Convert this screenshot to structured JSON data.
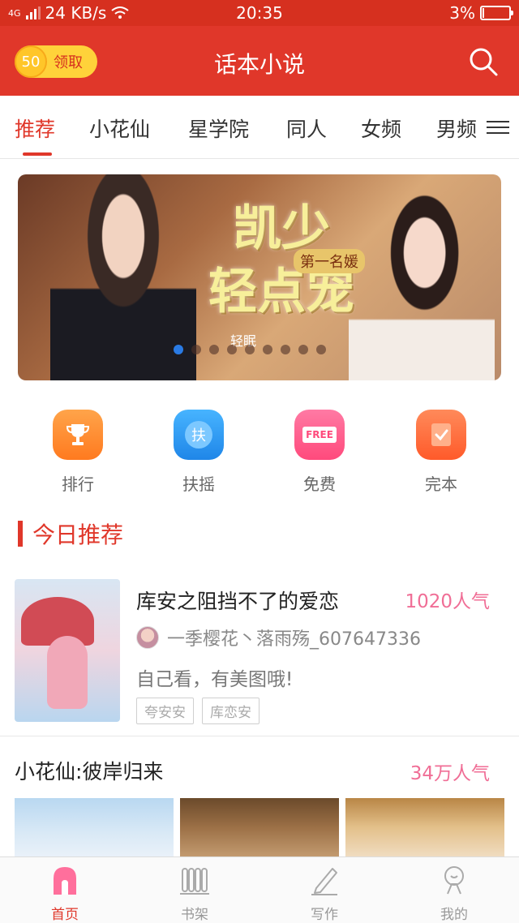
{
  "status_bar": {
    "network": "4G",
    "speed": "24 KB/s",
    "time": "20:35",
    "battery": "3%"
  },
  "header": {
    "coin_count": "50",
    "coin_label": "领取",
    "title": "话本小说"
  },
  "tabs": [
    {
      "label": "推荐",
      "active": true
    },
    {
      "label": "小花仙"
    },
    {
      "label": "星学院"
    },
    {
      "label": "同人"
    },
    {
      "label": "女频"
    },
    {
      "label": "男频"
    }
  ],
  "banner": {
    "title_line1": "凯少",
    "title_line2": "轻点宠",
    "subtitle": "第一名媛",
    "author": "轻眠",
    "total_slides": 9,
    "active_slide": 0
  },
  "quick_entries": [
    {
      "label": "排行",
      "icon": "trophy-icon",
      "color": "#ff8a2e"
    },
    {
      "label": "扶摇",
      "icon": "fuyao-icon",
      "icon_text": "扶",
      "color": "#2f9af0"
    },
    {
      "label": "免费",
      "icon": "free-icon",
      "icon_text": "FREE",
      "color": "#ff5a8a"
    },
    {
      "label": "完本",
      "icon": "check-book-icon",
      "color": "#ff6a3a"
    }
  ],
  "today": {
    "title": "今日推荐",
    "book": {
      "title": "库安之阻挡不了的爱恋",
      "popularity": "1020人气",
      "author": "一季樱花丶落雨殇_607647336",
      "description": "自己看，有美图哦!",
      "tags": [
        "夸安安",
        "库恋安"
      ]
    }
  },
  "section2": {
    "title": "小花仙:彼岸归来",
    "popularity": "34万人气"
  },
  "bottom_nav": [
    {
      "label": "首页",
      "icon": "home-icon",
      "active": true
    },
    {
      "label": "书架",
      "icon": "bookshelf-icon"
    },
    {
      "label": "写作",
      "icon": "pen-icon"
    },
    {
      "label": "我的",
      "icon": "profile-icon"
    }
  ],
  "colors": {
    "brand_red": "#e0372a",
    "popularity_pink": "#f06e96",
    "coin_yellow": "#ffd23a"
  }
}
